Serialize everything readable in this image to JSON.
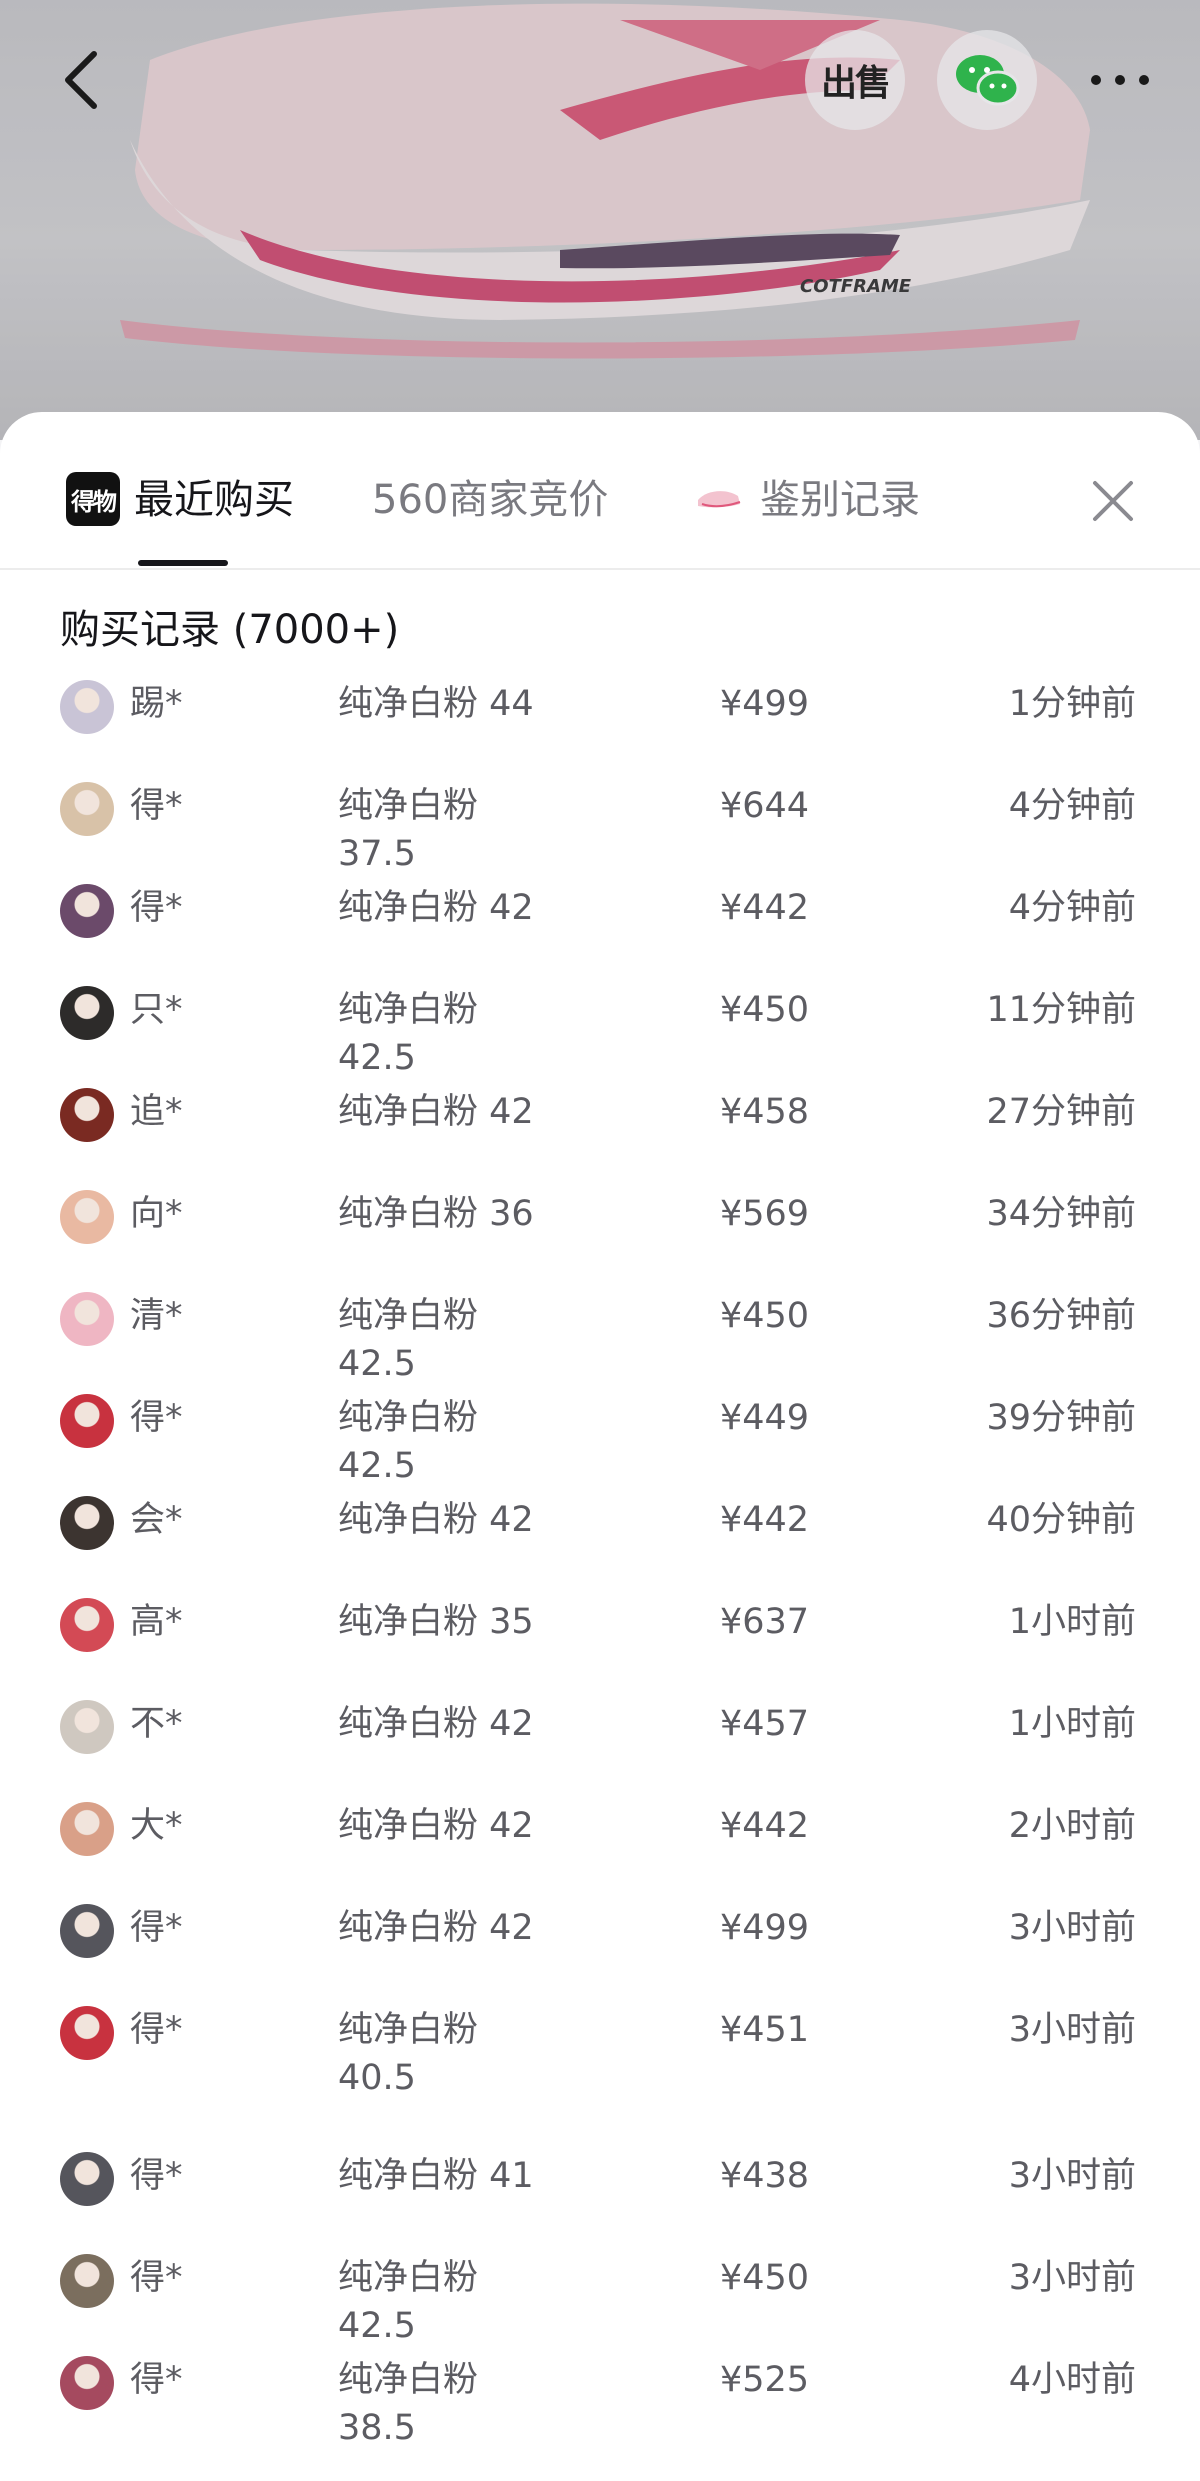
{
  "header": {
    "back_icon": "chevron-left-icon",
    "sell_label": "出售",
    "wechat_icon": "wechat-icon",
    "more_icon": "more-dots-icon",
    "product_print": "COTFRAME"
  },
  "tabs": [
    {
      "logo_text": "得物",
      "label": "最近购买",
      "active": true
    },
    {
      "label": "560商家竞价",
      "active": false
    },
    {
      "label": "鉴别记录",
      "active": false,
      "icon": "shoe-thumbnail-icon"
    }
  ],
  "close_icon": "close-icon",
  "records": {
    "title": "购买记录 (7000+)",
    "rows": [
      {
        "user": "踢*",
        "spec": "纯净白粉 44",
        "price": "¥499",
        "time": "1分钟前",
        "avatar_color": "#c9c4d6"
      },
      {
        "user": "得*",
        "spec": "纯净白粉 37.5",
        "price": "¥644",
        "time": "4分钟前",
        "avatar_color": "#d8c2a8"
      },
      {
        "user": "得*",
        "spec": "纯净白粉 42",
        "price": "¥442",
        "time": "4分钟前",
        "avatar_color": "#6b4a6a"
      },
      {
        "user": "只*",
        "spec": "纯净白粉 42.5",
        "price": "¥450",
        "time": "11分钟前",
        "avatar_color": "#2d2b2a"
      },
      {
        "user": "追*",
        "spec": "纯净白粉 42",
        "price": "¥458",
        "time": "27分钟前",
        "avatar_color": "#7a2a22"
      },
      {
        "user": "向*",
        "spec": "纯净白粉 36",
        "price": "¥569",
        "time": "34分钟前",
        "avatar_color": "#e9b9a2"
      },
      {
        "user": "清*",
        "spec": "纯净白粉 42.5",
        "price": "¥450",
        "time": "36分钟前",
        "avatar_color": "#efb6c3"
      },
      {
        "user": "得*",
        "spec": "纯净白粉 42.5",
        "price": "¥449",
        "time": "39分钟前",
        "avatar_color": "#c8323f"
      },
      {
        "user": "会*",
        "spec": "纯净白粉 42",
        "price": "¥442",
        "time": "40分钟前",
        "avatar_color": "#3c3430"
      },
      {
        "user": "高*",
        "spec": "纯净白粉 35",
        "price": "¥637",
        "time": "1小时前",
        "avatar_color": "#d34a55"
      },
      {
        "user": "不*",
        "spec": "纯净白粉 42",
        "price": "¥457",
        "time": "1小时前",
        "avatar_color": "#cfc8c0"
      },
      {
        "user": "大*",
        "spec": "纯净白粉 42",
        "price": "¥442",
        "time": "2小时前",
        "avatar_color": "#d9a088"
      },
      {
        "user": "得*",
        "spec": "纯净白粉 42",
        "price": "¥499",
        "time": "3小时前",
        "avatar_color": "#55555c"
      },
      {
        "user": "得*",
        "spec": "纯净白粉 40.5",
        "price": "¥451",
        "time": "3小时前",
        "avatar_color": "#c8323f"
      },
      {
        "user": "得*",
        "spec": "纯净白粉 41",
        "price": "¥438",
        "time": "3小时前",
        "avatar_color": "#55555c"
      },
      {
        "user": "得*",
        "spec": "纯净白粉 42.5",
        "price": "¥450",
        "time": "3小时前",
        "avatar_color": "#7b6e5e"
      },
      {
        "user": "得*",
        "spec": "纯净白粉 38.5",
        "price": "¥525",
        "time": "4小时前",
        "avatar_color": "#a54a5f"
      }
    ]
  }
}
